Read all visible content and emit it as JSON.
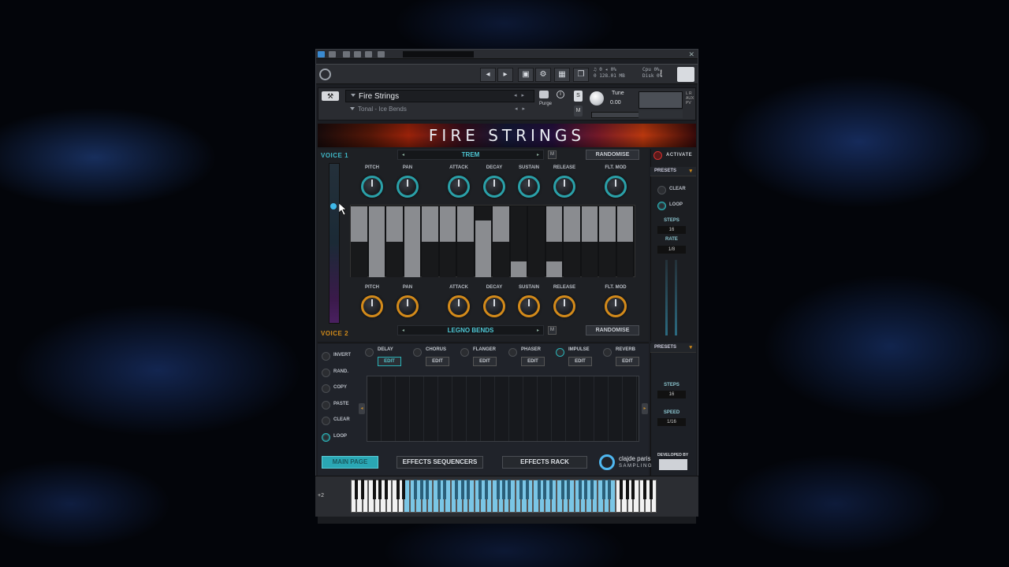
{
  "colors": {
    "accent_teal": "#2aa7b4",
    "accent_orange": "#d38a1a",
    "keyboard_highlight": "#7ac6e6"
  },
  "kontakt": {
    "stats_line1": "♫ 0 ◂ 0%",
    "stats_line2": "0 128.01 MB",
    "cpu": "Cpu 0%",
    "disk": "Disk 0%",
    "excl": "!"
  },
  "instrument": {
    "name": "Fire Strings",
    "subpatch": "Tonal - Ice Bends",
    "purge": "Purge",
    "s_label": "S",
    "m_label": "M",
    "tune_label": "Tune",
    "tune_value": "0.00",
    "aux": "L R AUX PV"
  },
  "banner_title": "FIRE STRINGS",
  "voice1": {
    "label": "VOICE 1",
    "articulation": "TREM",
    "m_label": "M",
    "randomise": "RANDOMISE",
    "knobs": [
      "PITCH",
      "PAN",
      "ATTACK",
      "DECAY",
      "SUSTAIN",
      "RELEASE",
      "FLT. MOD"
    ]
  },
  "voice2": {
    "label": "VOICE 2",
    "articulation": "LEGNO BENDS",
    "m_label": "M",
    "randomise": "RANDOMISE",
    "knobs": [
      "PITCH",
      "PAN",
      "ATTACK",
      "DECAY",
      "SUSTAIN",
      "RELEASE",
      "FLT. MOD"
    ]
  },
  "sequencer": {
    "top_row": [
      1,
      1,
      1,
      1,
      1,
      1,
      1,
      0.6,
      1,
      0,
      0,
      1,
      1,
      1,
      1,
      1
    ],
    "bottom_row": [
      0,
      1,
      0,
      1,
      0,
      0,
      0,
      1,
      0,
      0.45,
      0,
      0.45,
      0,
      0,
      0,
      0
    ]
  },
  "side_panel": {
    "activate": "ACTIVATE",
    "presets": "PRESETS",
    "clear": "CLEAR",
    "loop": "LOOP",
    "steps_label": "STEPS",
    "steps_value": "16",
    "rate_label": "RATE",
    "rate_value": "1/8"
  },
  "fx": {
    "left_controls": [
      "INVERT",
      "RAND.",
      "COPY",
      "PASTE",
      "CLEAR",
      "LOOP"
    ],
    "units": [
      {
        "name": "DELAY",
        "edit": "EDIT"
      },
      {
        "name": "CHORUS",
        "edit": "EDIT"
      },
      {
        "name": "FLANGER",
        "edit": "EDIT"
      },
      {
        "name": "PHASER",
        "edit": "EDIT"
      },
      {
        "name": "IMPULSE",
        "edit": "EDIT"
      },
      {
        "name": "REVERB",
        "edit": "EDIT"
      }
    ],
    "presets": "PRESETS",
    "steps_label": "STEPS",
    "steps_value": "16",
    "speed_label": "SPEED",
    "speed_value": "1/16"
  },
  "tabs": {
    "main": "MAIN PAGE",
    "effects_seq": "EFFECTS SEQUENCERS",
    "effects_rack": "EFFECTS RACK"
  },
  "brand": {
    "line1": "clajde paris",
    "line2": "SAMPLING",
    "developed_by": "DEVELOPED BY"
  },
  "keyboard": {
    "octave": "+2"
  }
}
